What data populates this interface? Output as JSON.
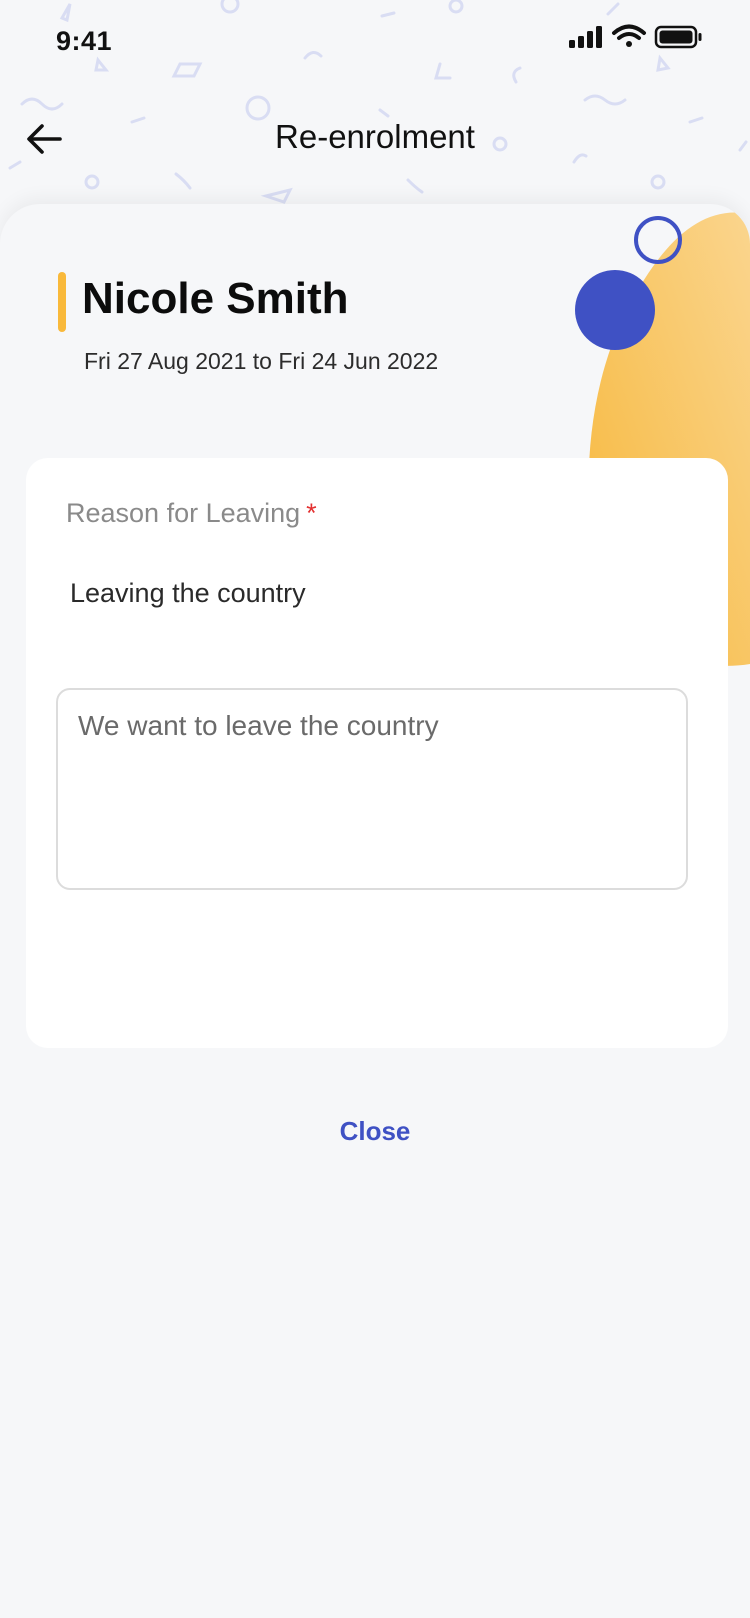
{
  "status_bar": {
    "time": "9:41",
    "icons": [
      "signal-icon",
      "wifi-icon",
      "battery-icon"
    ]
  },
  "header": {
    "title": "Re-enrolment",
    "back_icon": "arrow-left-icon"
  },
  "student": {
    "name": "Nicole Smith",
    "date_range": "Fri 27 Aug 2021 to Fri 24 Jun 2022"
  },
  "form": {
    "reason_label": "Reason for Leaving",
    "required_marker": "*",
    "reason_value": "Leaving the country",
    "notes_value": "We want to leave the country"
  },
  "actions": {
    "close_label": "Close"
  },
  "colors": {
    "accent_yellow": "#f9b93b",
    "brand_blue": "#3f51c4",
    "required_red": "#e33030",
    "background": "#f6f7f9"
  }
}
